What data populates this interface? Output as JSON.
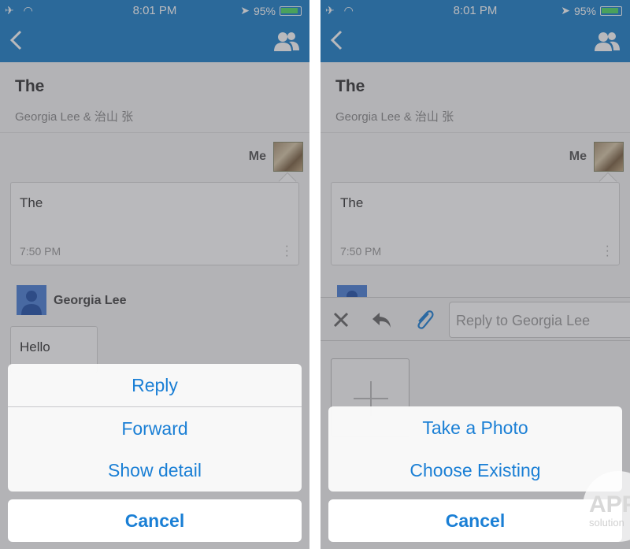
{
  "colors": {
    "nav_bar": "#1a7fc9",
    "action_blue": "#1a7fd5",
    "battery_fill": "#4cd964"
  },
  "status_bar": {
    "time": "8:01 PM",
    "battery": "95%"
  },
  "conversation": {
    "subject": "The",
    "participants": "Georgia Lee & 治山 张",
    "me_label": "Me",
    "my_message": {
      "text": "The",
      "time": "7:50 PM"
    },
    "other_sender": "Georgia Lee",
    "other_message": "Hello"
  },
  "left_sheet": {
    "items": [
      "Reply",
      "Forward",
      "Show detail"
    ],
    "cancel": "Cancel"
  },
  "reply_bar": {
    "placeholder": "Reply to Georgia Lee"
  },
  "right_sheet": {
    "items": [
      "Take a Photo",
      "Choose Existing"
    ],
    "cancel": "Cancel"
  },
  "watermark": {
    "line1": "APP",
    "line2": "solution"
  }
}
